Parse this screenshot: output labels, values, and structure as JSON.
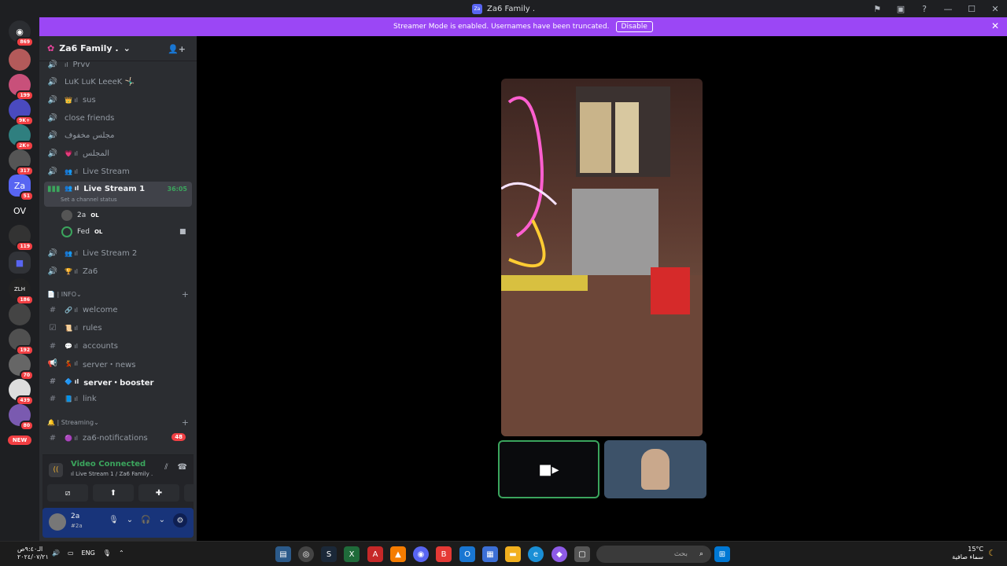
{
  "titlebar": {
    "title": "Za6 Family ."
  },
  "banner": {
    "text": "Streamer Mode is enabled. Usernames have been truncated.",
    "button": "Disable"
  },
  "servers": [
    {
      "label": "",
      "badge": "869"
    },
    {
      "label": "",
      "badge": ""
    },
    {
      "label": "",
      "badge": "199"
    },
    {
      "label": "",
      "badge": "9K+"
    },
    {
      "label": "",
      "badge": "2K+"
    },
    {
      "label": "",
      "badge": "317"
    },
    {
      "label": "Za",
      "badge": "51"
    },
    {
      "label": "OV",
      "badge": ""
    },
    {
      "label": "",
      "badge": "119"
    },
    {
      "label": "",
      "badge": ""
    },
    {
      "label": "ZLH",
      "badge": "186"
    },
    {
      "label": "",
      "badge": ""
    },
    {
      "label": "",
      "badge": "192"
    },
    {
      "label": "",
      "badge": "70"
    },
    {
      "label": "",
      "badge": "439"
    },
    {
      "label": "",
      "badge": "80"
    },
    {
      "label": "",
      "badge": "NEW"
    }
  ],
  "guild": {
    "name": "Za6 Family ."
  },
  "channels": [
    {
      "prefix": "ıl",
      "name": "Prvv"
    },
    {
      "prefix": "",
      "name": "LuK LuK LeeeK 🤸🏻‍♂️"
    },
    {
      "prefix": "👑 ıl",
      "name": "sus"
    },
    {
      "prefix": "",
      "name": "close friends"
    },
    {
      "prefix": "",
      "name": "مجلس مخفوف"
    },
    {
      "prefix": "💗 ıl",
      "name": "المجلس"
    },
    {
      "prefix": "👥 ıl",
      "name": "Live Stream"
    },
    {
      "prefix": "👥 ıl",
      "name": "Live Stream 1",
      "timer": "36:05",
      "status": "Set a channel status"
    },
    {
      "prefix": "👥 ıl",
      "name": "Live Stream 2"
    },
    {
      "prefix": "🏆 ıl",
      "name": "Za6"
    }
  ],
  "voice_users": [
    {
      "name": "2a",
      "tag": "OL"
    },
    {
      "name": "Fed",
      "tag": "OL"
    }
  ],
  "info_category": {
    "label": "📄 | INFO"
  },
  "info_channels": [
    {
      "prefix": "🔗 ıl",
      "name": "welcome"
    },
    {
      "prefix": "📜 ıl",
      "name": "rules"
    },
    {
      "prefix": "💬 ıl",
      "name": "accounts"
    },
    {
      "prefix": "💃 ıl",
      "name": "server・news"
    },
    {
      "prefix": "🔷 ıl",
      "name": "server・booster"
    },
    {
      "prefix": "📘 ıl",
      "name": "link"
    }
  ],
  "streaming_category": {
    "label": "🔔 | Streaming"
  },
  "streaming_channels": [
    {
      "prefix": "🟣 ıl",
      "name": "za6-notifications",
      "unread": "48"
    }
  ],
  "voice_panel": {
    "status": "Video Connected",
    "location": "ıl Live Stream 1 / Za6 Family ."
  },
  "user": {
    "name": "2a",
    "status": "#2a"
  },
  "taskbar": {
    "search": "بحث",
    "lang": "ENG",
    "time": "الـ٩:٤٠ص",
    "date": "٢٠٢٤/٠٧/٢١",
    "temp": "15°C",
    "weather": "سماء صافية"
  }
}
